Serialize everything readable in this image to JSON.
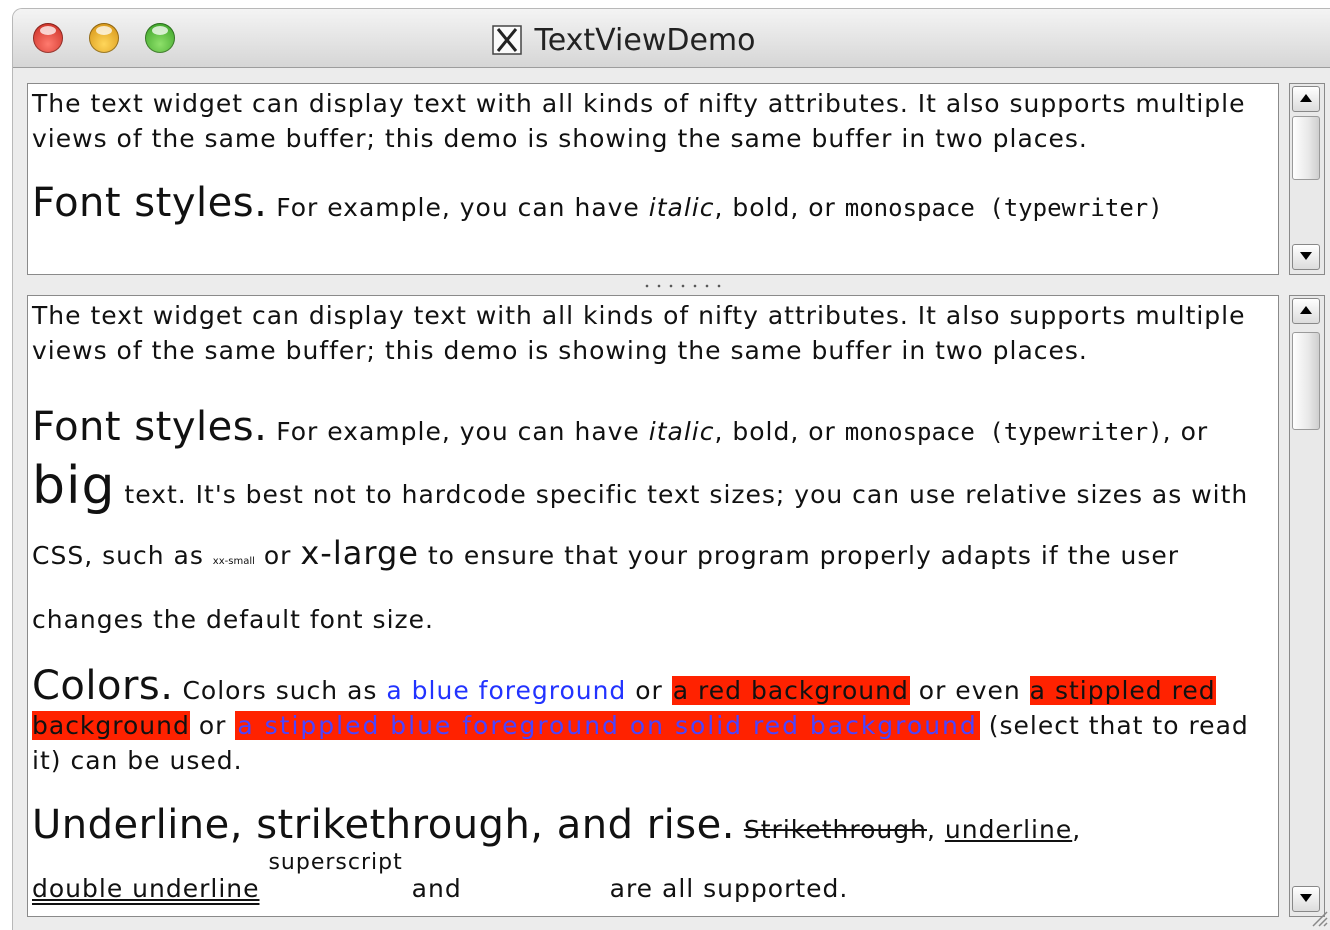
{
  "window": {
    "title": "TextViewDemo",
    "app_icon": "x-window-icon"
  },
  "colors": {
    "blue_foreground": "#2233ff",
    "red_background": "#ff2200",
    "stippled_blue": "#4a44ff"
  },
  "buffer": {
    "intro": "The text widget can display text with all kinds of nifty attributes. It also supports multiple views of the same buffer; this demo is showing the same buffer in two places.",
    "font_styles": {
      "heading": "Font styles.",
      "t1": " For example, you can have ",
      "italic": "italic",
      "t2": ", bold, or ",
      "monospace": "monospace (typewriter)",
      "t3": ", or ",
      "big": "big",
      "t4": " text. It's best not to hardcode specific text sizes; you can use relative sizes as with CSS, such as ",
      "xx_small": "xx-small",
      "t5": " or ",
      "x_large": "x-large",
      "t6": " to ensure that your program properly adapts if the user changes the default font size."
    },
    "colors_section": {
      "heading": "Colors.",
      "t1": " Colors such as ",
      "blue_fg": "a blue foreground",
      "t2": " or ",
      "red_bg": "a red background",
      "t3": " or even ",
      "stippled_red_bg": "a stippled red background",
      "t4": " or ",
      "stippled_blue": "a stippled blue foreground on solid red background",
      "t5": " (select that to read it) can be used."
    },
    "underline_section": {
      "heading": "Underline, strikethrough, and rise.",
      "t1": " ",
      "strike": "Strikethrough",
      "t2": ", ",
      "underline": "underline",
      "t3": ",",
      "double_underline": "double underline",
      "superscript": "superscript",
      "t4": "and",
      "t5": "are all supported."
    }
  }
}
